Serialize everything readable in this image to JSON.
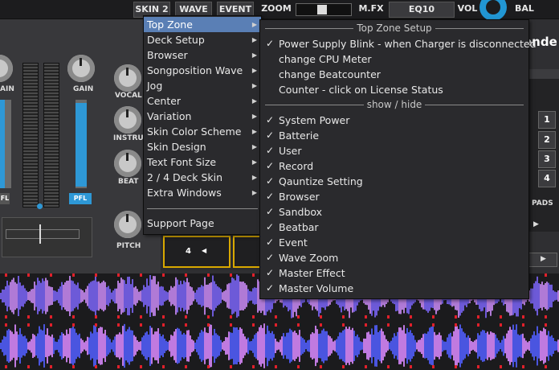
{
  "topbar": {
    "buttons": [
      "SKIN 2",
      "WAVE",
      "EVENT",
      "ZOOM",
      "M.FX",
      "EQ10",
      "VOL",
      "BAL"
    ]
  },
  "mixer": {
    "gain_left": "AIN",
    "gain_right": "GAIN",
    "vocal": "VOCAL",
    "instru": "INSTRU",
    "beat": "BEAT",
    "pitch": "PITCH",
    "pfl_left": "FL",
    "pfl_right": "PFL"
  },
  "deck": {
    "brand": "ende",
    "num_buttons": [
      "1",
      "2",
      "3",
      "4"
    ],
    "pads": "PADS",
    "loop_value": "4"
  },
  "menu": {
    "items": [
      {
        "label": "Top Zone",
        "submenu": true,
        "selected": true
      },
      {
        "label": "Deck Setup",
        "submenu": true
      },
      {
        "label": "Browser",
        "submenu": true
      },
      {
        "label": "Songposition Wave",
        "submenu": true
      },
      {
        "label": "Jog",
        "submenu": true
      },
      {
        "label": "Center",
        "submenu": true
      },
      {
        "label": "Variation",
        "submenu": true
      },
      {
        "label": "Skin Color Scheme",
        "submenu": true
      },
      {
        "label": "Skin Design",
        "submenu": true
      },
      {
        "label": "Text Font Size",
        "submenu": true
      },
      {
        "label": "2 / 4 Deck Skin",
        "submenu": true
      },
      {
        "label": "Extra Windows",
        "submenu": true
      }
    ],
    "support": "Support Page"
  },
  "submenu": {
    "header_setup": "Top Zone Setup",
    "setup_items": [
      {
        "label": "Power Supply Blink - when Charger is disconnected",
        "checked": true
      },
      {
        "label": "change CPU Meter",
        "checked": false
      },
      {
        "label": "change Beatcounter",
        "checked": false
      },
      {
        "label": "Counter - click on License Status",
        "checked": false
      }
    ],
    "header_show": "show / hide",
    "show_items": [
      {
        "label": "System Power",
        "checked": true
      },
      {
        "label": "Batterie",
        "checked": true
      },
      {
        "label": "User",
        "checked": true
      },
      {
        "label": "Record",
        "checked": true
      },
      {
        "label": "Qauntize Setting",
        "checked": true
      },
      {
        "label": "Browser",
        "checked": true
      },
      {
        "label": "Sandbox",
        "checked": true
      },
      {
        "label": "Beatbar",
        "checked": true
      },
      {
        "label": "Event",
        "checked": true
      },
      {
        "label": "Wave Zoom",
        "checked": true
      },
      {
        "label": "Master Effect",
        "checked": true
      },
      {
        "label": "Master Volume",
        "checked": true
      }
    ]
  },
  "icons": {
    "check": "✓",
    "arrow": "▶",
    "left_arrow": "◀"
  }
}
